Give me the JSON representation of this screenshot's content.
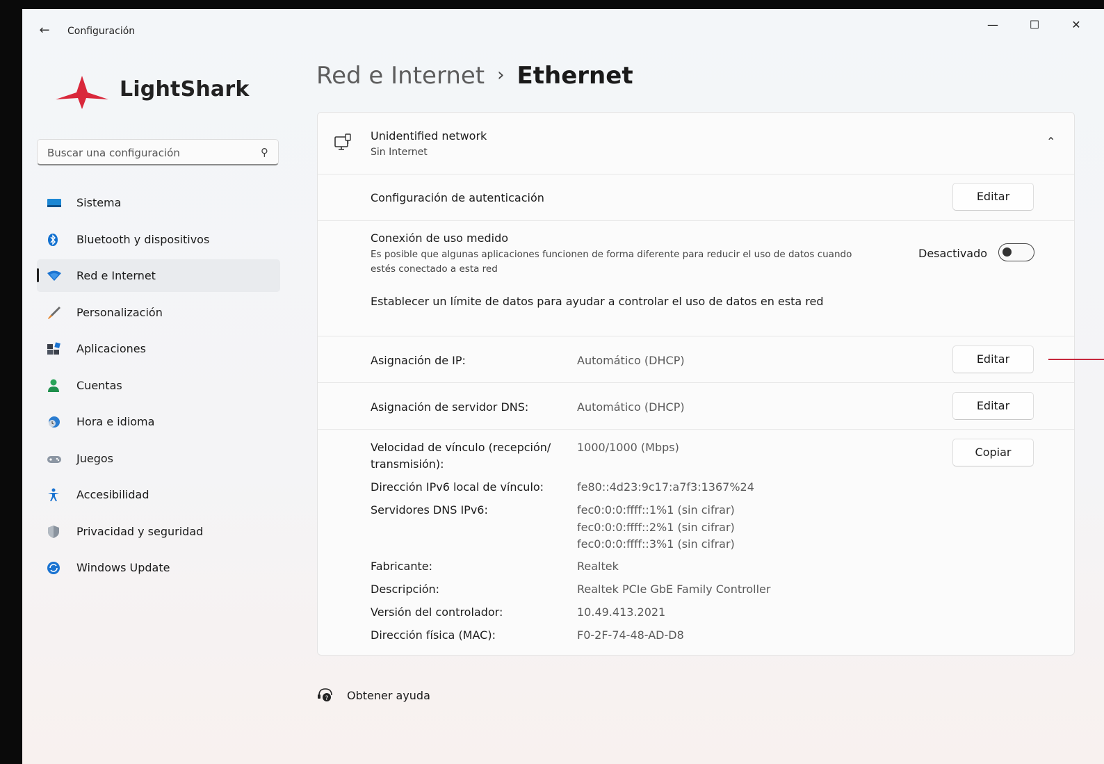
{
  "window": {
    "title": "Configuración"
  },
  "logo": {
    "text": "LightShark"
  },
  "search": {
    "placeholder": "Buscar una configuración"
  },
  "nav": {
    "items": [
      {
        "label": "Sistema",
        "icon": "monitor-icon"
      },
      {
        "label": "Bluetooth y dispositivos",
        "icon": "bluetooth-icon"
      },
      {
        "label": "Red e Internet",
        "icon": "wifi-icon",
        "active": true
      },
      {
        "label": "Personalización",
        "icon": "brush-icon"
      },
      {
        "label": "Aplicaciones",
        "icon": "apps-icon"
      },
      {
        "label": "Cuentas",
        "icon": "person-icon"
      },
      {
        "label": "Hora e idioma",
        "icon": "clock-globe-icon"
      },
      {
        "label": "Juegos",
        "icon": "gamepad-icon"
      },
      {
        "label": "Accesibilidad",
        "icon": "accessibility-icon"
      },
      {
        "label": "Privacidad y seguridad",
        "icon": "shield-icon"
      },
      {
        "label": "Windows Update",
        "icon": "update-icon"
      }
    ]
  },
  "breadcrumb": {
    "parent": "Red e Internet",
    "separator": "›",
    "current": "Ethernet"
  },
  "network": {
    "name": "Unidentified network",
    "status": "Sin Internet",
    "auth_label": "Configuración de autenticación",
    "metered_label": "Conexión de uso medido",
    "metered_desc_line1": "Es posible que algunas aplicaciones funcionen de forma diferente para reducir el uso de datos cuando",
    "metered_desc_line2": "estés conectado a esta red",
    "metered_state": "Desactivado",
    "metered_on": false,
    "data_limit_link": "Establecer un límite de datos para ayudar a controlar el uso de datos en esta red",
    "ip_label": "Asignación de IP:",
    "ip_value": "Automático (DHCP)",
    "dns_label": "Asignación de servidor DNS:",
    "dns_value": "Automático (DHCP)",
    "edit_label": "Editar",
    "copy_label": "Copiar",
    "speed_label_line1": "Velocidad de vínculo (recepción/",
    "speed_label_line2": "transmisión):",
    "speed_value": "1000/1000 (Mbps)",
    "ipv6_label": "Dirección IPv6 local de vínculo:",
    "ipv6_value": "fe80::4d23:9c17:a7f3:1367%24",
    "dns6_label": "Servidores DNS IPv6:",
    "dns6_values": [
      "fec0:0:0:ffff::1%1 (sin cifrar)",
      "fec0:0:0:ffff::2%1 (sin cifrar)",
      "fec0:0:0:ffff::3%1 (sin cifrar)"
    ],
    "maker_label": "Fabricante:",
    "maker_value": "Realtek",
    "desc_label": "Descripción:",
    "desc_value": "Realtek PCIe GbE Family Controller",
    "driver_label": "Versión del controlador:",
    "driver_value": "10.49.413.2021",
    "mac_label": "Dirección física (MAC):",
    "mac_value": "F0-2F-74-48-AD-D8"
  },
  "help": {
    "label": "Obtener ayuda"
  },
  "colors": {
    "accent": "#0067c0",
    "logo_red": "#d9283b",
    "annotation_line": "#c5283d"
  }
}
